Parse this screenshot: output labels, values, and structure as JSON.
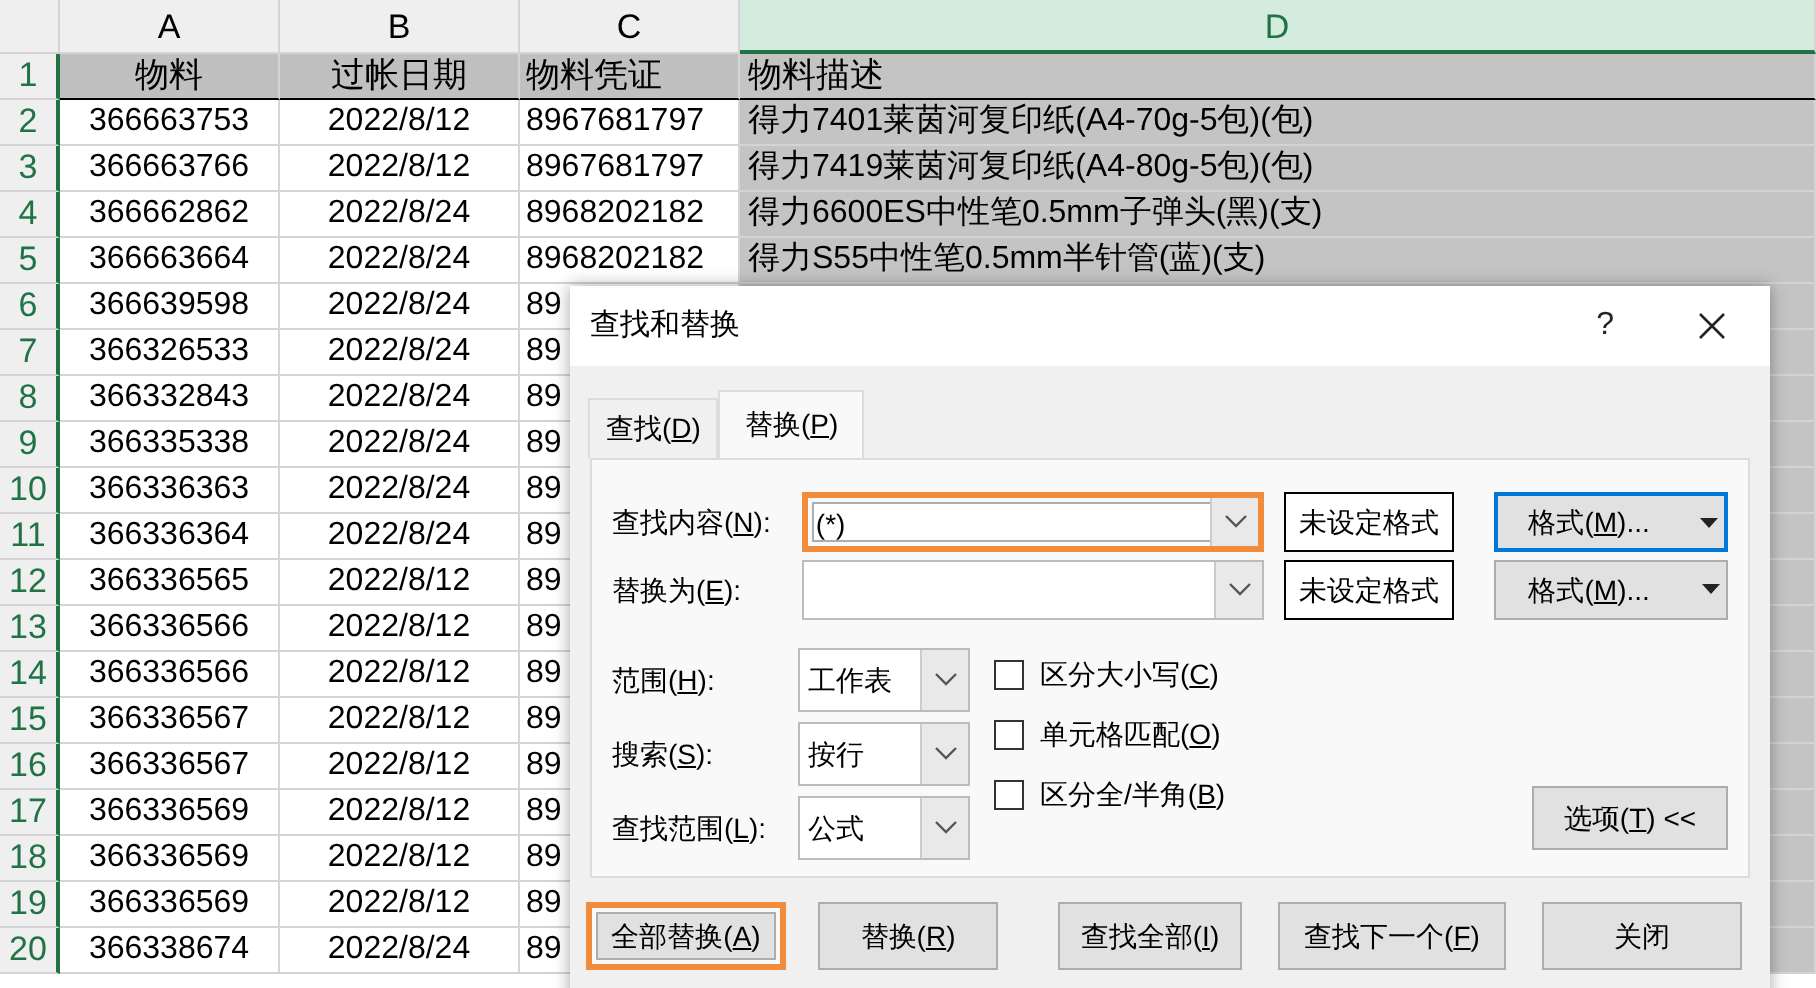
{
  "spreadsheet": {
    "columns": [
      {
        "label": "A",
        "selected": false
      },
      {
        "label": "B",
        "selected": false
      },
      {
        "label": "C",
        "selected": false
      },
      {
        "label": "D",
        "selected": true
      }
    ],
    "rows": [
      {
        "number": "1",
        "kind": "header",
        "cells": [
          "物料",
          "过帐日期",
          "物料凭证",
          "物料描述"
        ]
      },
      {
        "number": "2",
        "kind": "data",
        "cells": [
          "366663753",
          "2022/8/12",
          "8967681797",
          "得力7401莱茵河复印纸(A4-70g-5包)(包)"
        ]
      },
      {
        "number": "3",
        "kind": "data",
        "cells": [
          "366663766",
          "2022/8/12",
          "8967681797",
          "得力7419莱茵河复印纸(A4-80g-5包)(包)"
        ]
      },
      {
        "number": "4",
        "kind": "data",
        "cells": [
          "366662862",
          "2022/8/24",
          "8968202182",
          "得力6600ES中性笔0.5mm子弹头(黑)(支)"
        ]
      },
      {
        "number": "5",
        "kind": "data",
        "cells": [
          "366663664",
          "2022/8/24",
          "8968202182",
          "得力S55中性笔0.5mm半针管(蓝)(支)"
        ]
      },
      {
        "number": "6",
        "kind": "data",
        "cells": [
          "366639598",
          "2022/8/24",
          "89"
        ]
      },
      {
        "number": "7",
        "kind": "data",
        "cells": [
          "366326533",
          "2022/8/24",
          "89"
        ]
      },
      {
        "number": "8",
        "kind": "data",
        "cells": [
          "366332843",
          "2022/8/24",
          "89"
        ]
      },
      {
        "number": "9",
        "kind": "data",
        "cells": [
          "366335338",
          "2022/8/24",
          "89"
        ]
      },
      {
        "number": "10",
        "kind": "data",
        "cells": [
          "366336363",
          "2022/8/24",
          "89"
        ]
      },
      {
        "number": "11",
        "kind": "data",
        "cells": [
          "366336364",
          "2022/8/24",
          "89"
        ]
      },
      {
        "number": "12",
        "kind": "data",
        "cells": [
          "366336565",
          "2022/8/12",
          "89"
        ]
      },
      {
        "number": "13",
        "kind": "data",
        "cells": [
          "366336566",
          "2022/8/12",
          "89"
        ]
      },
      {
        "number": "14",
        "kind": "data",
        "cells": [
          "366336566",
          "2022/8/12",
          "89"
        ]
      },
      {
        "number": "15",
        "kind": "data",
        "cells": [
          "366336567",
          "2022/8/12",
          "89"
        ]
      },
      {
        "number": "16",
        "kind": "data",
        "cells": [
          "366336567",
          "2022/8/12",
          "89"
        ]
      },
      {
        "number": "17",
        "kind": "data",
        "cells": [
          "366336569",
          "2022/8/12",
          "89"
        ]
      },
      {
        "number": "18",
        "kind": "data",
        "cells": [
          "366336569",
          "2022/8/12",
          "89"
        ]
      },
      {
        "number": "19",
        "kind": "data",
        "cells": [
          "366336569",
          "2022/8/12",
          "89"
        ]
      },
      {
        "number": "20",
        "kind": "data",
        "cells": [
          "366338674",
          "2022/8/24",
          "89"
        ]
      }
    ]
  },
  "dialog": {
    "title": "查找和替换",
    "help": "?",
    "tabs": [
      {
        "label": [
          "查找(",
          "D",
          ")"
        ],
        "selected": false
      },
      {
        "label": [
          "替换(",
          "P",
          ")"
        ],
        "selected": true
      }
    ],
    "find": {
      "label": [
        "查找内容(",
        "N",
        "):"
      ],
      "value": "(*)",
      "highlighted": true,
      "format_status": "未设定格式",
      "format_button": [
        "格式(",
        "M",
        ")..."
      ],
      "format_focused": true
    },
    "replace": {
      "label": [
        "替换为(",
        "E",
        "):"
      ],
      "highlighted": false,
      "format_status": "未设定格式",
      "format_button": [
        "格式(",
        "M",
        ")..."
      ],
      "format_focused": false
    },
    "selects": [
      {
        "label": [
          "范围(",
          "H",
          "):"
        ],
        "value": "工作表"
      },
      {
        "label": [
          "搜索(",
          "S",
          "):"
        ],
        "value": "按行"
      },
      {
        "label": [
          "查找范围(",
          "L",
          "):"
        ],
        "value": "公式"
      }
    ],
    "checkboxes": [
      {
        "label": [
          "区分大小写(",
          "C",
          ")"
        ],
        "checked": false
      },
      {
        "label": [
          "单元格匹配(",
          "O",
          ")"
        ],
        "checked": false
      },
      {
        "label": [
          "区分全/半角(",
          "B",
          ")"
        ],
        "checked": false
      }
    ],
    "options_button": [
      "选项(",
      "T",
      ") <<"
    ],
    "buttons": [
      {
        "label": [
          "全部替换(",
          "A",
          ")"
        ],
        "highlighted": true
      },
      {
        "label": [
          "替换(",
          "R",
          ")"
        ],
        "highlighted": false
      },
      {
        "label": [
          "查找全部(",
          "I",
          ")"
        ],
        "highlighted": false
      },
      {
        "label": [
          "查找下一个(",
          "F",
          ")"
        ],
        "highlighted": false
      },
      {
        "label": [
          "关闭"
        ],
        "highlighted": false
      }
    ]
  }
}
